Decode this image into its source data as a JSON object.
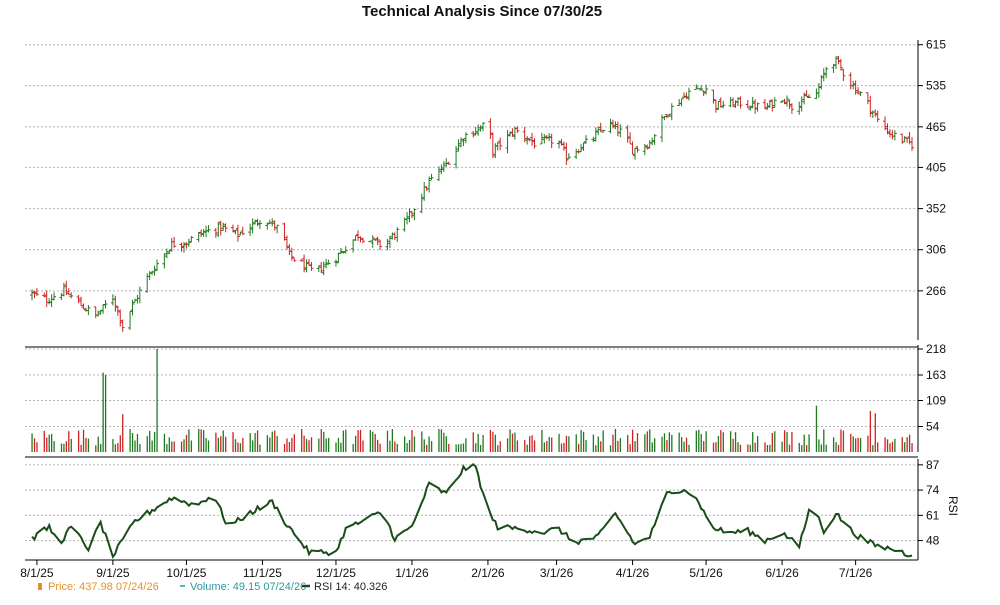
{
  "chart_data": {
    "type": "ohlc",
    "title": "Technical Analysis Since 07/30/25",
    "colors": {
      "up": "#1f7a1f",
      "down": "#cc2222",
      "rsi_line": "#1a4d1a",
      "grid": "#b4b4b4",
      "price_legend": "#e8902a",
      "volume_legend": "#2a9aa0",
      "rsi_legend": "#1a4d1a"
    },
    "x_axis": {
      "ticks": [
        {
          "date": "2025-08-01",
          "label": "8/1/25"
        },
        {
          "date": "2025-09-01",
          "label": "9/1/25"
        },
        {
          "date": "2025-10-01",
          "label": "10/1/25"
        },
        {
          "date": "2025-11-01",
          "label": "11/1/25"
        },
        {
          "date": "2025-12-01",
          "label": "12/1/25"
        },
        {
          "date": "2026-01-01",
          "label": "1/1/26"
        },
        {
          "date": "2026-02-01",
          "label": "2/1/26"
        },
        {
          "date": "2026-03-01",
          "label": "3/1/26"
        },
        {
          "date": "2026-04-01",
          "label": "4/1/26"
        },
        {
          "date": "2026-05-01",
          "label": "5/1/26"
        },
        {
          "date": "2026-06-01",
          "label": "6/1/26"
        },
        {
          "date": "2026-07-01",
          "label": "7/1/26"
        }
      ],
      "range": [
        "2025-07-30",
        "2026-07-24"
      ]
    },
    "price_panel": {
      "yticks": [
        "615",
        "535",
        "465",
        "405",
        "352",
        "306",
        "266"
      ],
      "ylim": [
        225,
        625
      ],
      "scale": "log",
      "anchors": [
        [
          "2025-07-30",
          263
        ],
        [
          "2025-08-05",
          258
        ],
        [
          "2025-08-12",
          266
        ],
        [
          "2025-08-20",
          252
        ],
        [
          "2025-08-25",
          244
        ],
        [
          "2025-09-01",
          260
        ],
        [
          "2025-09-05",
          236
        ],
        [
          "2025-09-15",
          278
        ],
        [
          "2025-09-25",
          312
        ],
        [
          "2025-10-01",
          314
        ],
        [
          "2025-10-08",
          325
        ],
        [
          "2025-10-15",
          330
        ],
        [
          "2025-10-22",
          322
        ],
        [
          "2025-11-01",
          341
        ],
        [
          "2025-11-08",
          328
        ],
        [
          "2025-11-12",
          300
        ],
        [
          "2025-11-22",
          283
        ],
        [
          "2025-12-01",
          298
        ],
        [
          "2025-12-10",
          322
        ],
        [
          "2025-12-20",
          310
        ],
        [
          "2025-12-28",
          330
        ],
        [
          "2026-01-01",
          348
        ],
        [
          "2026-01-08",
          385
        ],
        [
          "2026-01-15",
          410
        ],
        [
          "2026-01-22",
          450
        ],
        [
          "2026-02-01",
          470
        ],
        [
          "2026-02-03",
          428
        ],
        [
          "2026-02-12",
          460
        ],
        [
          "2026-02-20",
          440
        ],
        [
          "2026-03-01",
          445
        ],
        [
          "2026-03-05",
          420
        ],
        [
          "2026-03-15",
          445
        ],
        [
          "2026-03-22",
          470
        ],
        [
          "2026-03-28",
          455
        ],
        [
          "2026-04-01",
          430
        ],
        [
          "2026-04-08",
          440
        ],
        [
          "2026-04-15",
          488
        ],
        [
          "2026-04-25",
          528
        ],
        [
          "2026-05-01",
          530
        ],
        [
          "2026-05-05",
          500
        ],
        [
          "2026-05-15",
          505
        ],
        [
          "2026-05-25",
          495
        ],
        [
          "2026-06-01",
          515
        ],
        [
          "2026-06-05",
          500
        ],
        [
          "2026-06-15",
          520
        ],
        [
          "2026-06-20",
          580
        ],
        [
          "2026-06-23",
          582
        ],
        [
          "2026-06-28",
          545
        ],
        [
          "2026-07-05",
          510
        ],
        [
          "2026-07-10",
          475
        ],
        [
          "2026-07-15",
          455
        ],
        [
          "2026-07-20",
          445
        ],
        [
          "2026-07-24",
          438
        ]
      ]
    },
    "volume_panel": {
      "yticks": [
        "218",
        "163",
        "109",
        "54"
      ],
      "ylim": [
        0,
        218
      ],
      "baseline": 40,
      "spikes": [
        [
          "2025-08-28",
          168
        ],
        [
          "2025-08-29",
          163
        ],
        [
          "2025-09-19",
          218
        ],
        [
          "2025-09-05",
          80
        ],
        [
          "2025-12-22",
          45
        ],
        [
          "2026-06-15",
          98
        ],
        [
          "2026-07-07",
          87
        ],
        [
          "2026-07-09",
          82
        ]
      ]
    },
    "rsi_panel": {
      "yticks": [
        "87",
        "74",
        "61",
        "48"
      ],
      "ylim": [
        38,
        90
      ],
      "ylabel": "RSI",
      "anchors": [
        [
          "2025-07-30",
          49
        ],
        [
          "2025-08-06",
          55
        ],
        [
          "2025-08-10",
          46
        ],
        [
          "2025-08-15",
          55
        ],
        [
          "2025-08-22",
          44
        ],
        [
          "2025-08-27",
          57
        ],
        [
          "2025-09-01",
          40
        ],
        [
          "2025-09-10",
          58
        ],
        [
          "2025-09-25",
          70
        ],
        [
          "2025-10-05",
          66
        ],
        [
          "2025-10-12",
          72
        ],
        [
          "2025-10-18",
          55
        ],
        [
          "2025-10-28",
          63
        ],
        [
          "2025-11-05",
          68
        ],
        [
          "2025-11-10",
          58
        ],
        [
          "2025-11-20",
          42
        ],
        [
          "2025-12-01",
          42
        ],
        [
          "2025-12-05",
          54
        ],
        [
          "2025-12-12",
          58
        ],
        [
          "2025-12-20",
          63
        ],
        [
          "2025-12-25",
          49
        ],
        [
          "2026-01-01",
          55
        ],
        [
          "2026-01-08",
          77
        ],
        [
          "2026-01-15",
          72
        ],
        [
          "2026-01-22",
          85
        ],
        [
          "2026-01-27",
          86
        ],
        [
          "2026-02-01",
          63
        ],
        [
          "2026-02-05",
          55
        ],
        [
          "2026-02-15",
          54
        ],
        [
          "2026-02-25",
          52
        ],
        [
          "2026-03-01",
          55
        ],
        [
          "2026-03-08",
          47
        ],
        [
          "2026-03-18",
          50
        ],
        [
          "2026-03-25",
          62
        ],
        [
          "2026-04-02",
          46
        ],
        [
          "2026-04-08",
          50
        ],
        [
          "2026-04-15",
          72
        ],
        [
          "2026-04-22",
          75
        ],
        [
          "2026-04-28",
          68
        ],
        [
          "2026-05-03",
          55
        ],
        [
          "2026-05-10",
          52
        ],
        [
          "2026-05-18",
          53
        ],
        [
          "2026-05-25",
          48
        ],
        [
          "2026-06-01",
          52
        ],
        [
          "2026-06-08",
          45
        ],
        [
          "2026-06-13",
          68
        ],
        [
          "2026-06-18",
          53
        ],
        [
          "2026-06-23",
          62
        ],
        [
          "2026-06-30",
          52
        ],
        [
          "2026-07-05",
          48
        ],
        [
          "2026-07-10",
          45
        ],
        [
          "2026-07-15",
          44
        ],
        [
          "2026-07-20",
          42
        ],
        [
          "2026-07-24",
          40.3
        ]
      ]
    },
    "legend": [
      {
        "key": "price",
        "marker": "bar",
        "text": "Price: 437.98  07/24/26"
      },
      {
        "key": "volume",
        "marker": "dash",
        "text": "Volume: 49.15  07/24/26"
      },
      {
        "key": "rsi",
        "marker": "line",
        "text": "RSI 14: 40.326"
      }
    ]
  }
}
